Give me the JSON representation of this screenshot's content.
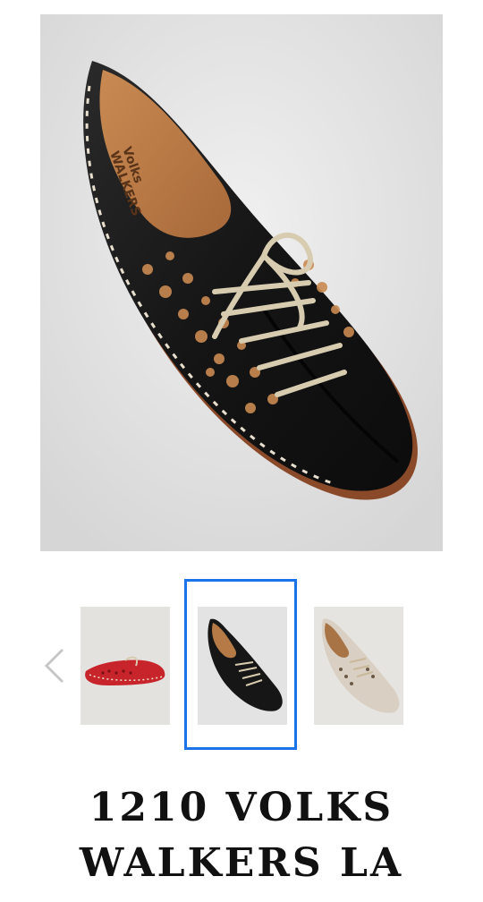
{
  "product": {
    "title_line1": "1210 VOLKS",
    "title_line2": "WALKERS LA"
  },
  "gallery": {
    "main_image_name": "black-perforated-lace-up-shoe",
    "prev_icon": "chevron-left-icon",
    "selected_index": 1,
    "thumbnails": [
      {
        "name": "red-shoe-thumbnail",
        "color": "#c8242b"
      },
      {
        "name": "black-shoe-thumbnail",
        "color": "#1b1b1b"
      },
      {
        "name": "cream-shoe-thumbnail",
        "color": "#d9cfc2"
      }
    ],
    "selected_border_color": "#1a73e8"
  }
}
